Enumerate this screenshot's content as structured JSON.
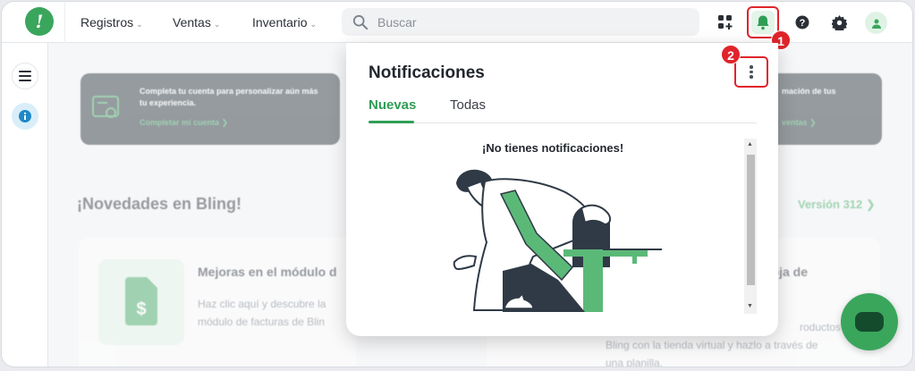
{
  "nav": {
    "logo": "!",
    "items": [
      {
        "label": "Registros"
      },
      {
        "label": "Ventas"
      },
      {
        "label": "Inventario"
      }
    ],
    "search_placeholder": "Buscar"
  },
  "top_icons": [
    "apps-icon",
    "bell-icon",
    "help-icon",
    "gear-icon",
    "user-icon"
  ],
  "background": {
    "banner_left": {
      "text": "Completa tu cuenta para personalizar aún más tu experiencia.",
      "link": "Completar mi cuenta  ❯"
    },
    "banner_right": {
      "text": "mación de tus",
      "link": "ventas  ❯"
    },
    "section_title": "¡Novedades en Bling!",
    "version_link": "Versión 312  ❯",
    "card_left": {
      "title": "Mejoras en el módulo d",
      "desc_line1": "Haz clic aquí y descubre la",
      "desc_line2": "módulo de facturas de Blin"
    },
    "card_right": {
      "title": "hoja de",
      "desc_line1": "roductos de",
      "desc_line2": "Bling con la tienda virtual y hazlo a través de",
      "desc_line3": "una planilla."
    }
  },
  "notifications": {
    "title": "Notificaciones",
    "tabs": [
      {
        "label": "Nuevas",
        "active": true
      },
      {
        "label": "Todas",
        "active": false
      }
    ],
    "empty_message": "¡No tienes notificaciones!"
  },
  "annotations": {
    "badge_1": "1",
    "badge_2": "2"
  },
  "colors": {
    "brand_green": "#3aa65c",
    "highlight_red": "#e0242b",
    "dark_card": "#1f2a33"
  }
}
